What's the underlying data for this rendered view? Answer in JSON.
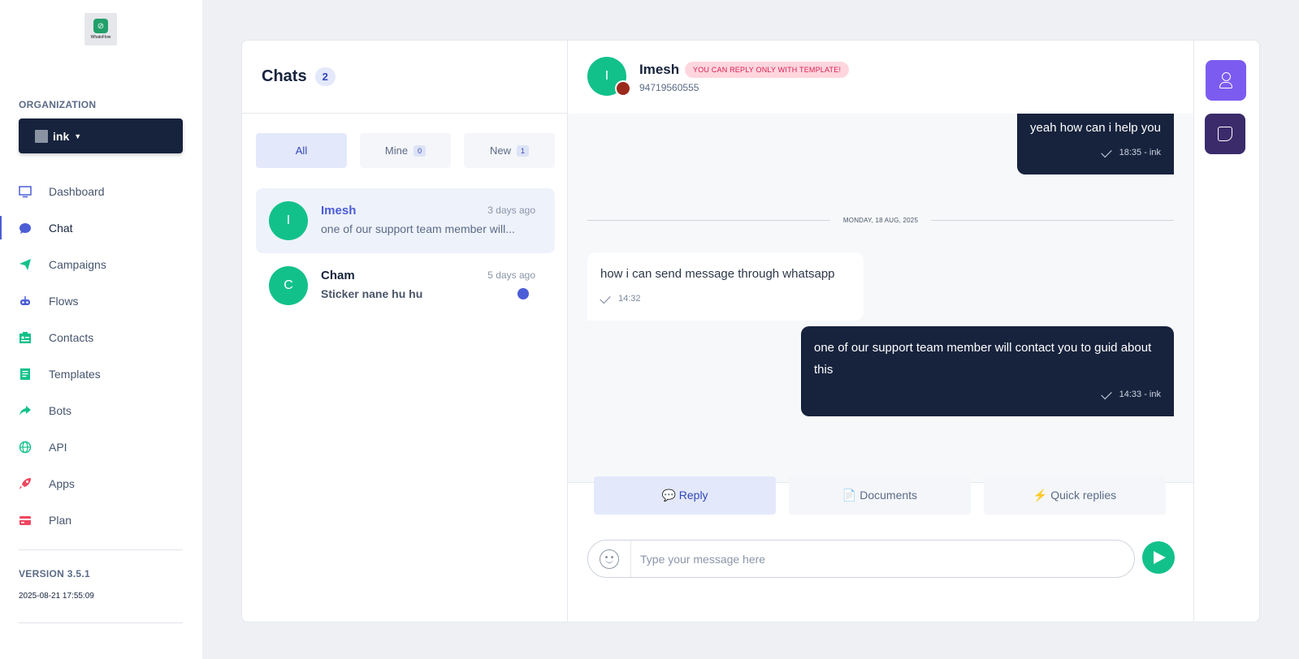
{
  "brand": {
    "logo_text": "WhatsFlow"
  },
  "organization": {
    "label": "ORGANIZATION",
    "name": "ink"
  },
  "nav": [
    {
      "label": "Dashboard",
      "icon": "monitor-icon"
    },
    {
      "label": "Chat",
      "icon": "chat-bubble-icon"
    },
    {
      "label": "Campaigns",
      "icon": "paper-plane-icon"
    },
    {
      "label": "Flows",
      "icon": "robot-icon"
    },
    {
      "label": "Contacts",
      "icon": "id-card-icon"
    },
    {
      "label": "Templates",
      "icon": "document-icon"
    },
    {
      "label": "Bots",
      "icon": "share-arrow-icon"
    },
    {
      "label": "API",
      "icon": "globe-icon"
    },
    {
      "label": "Apps",
      "icon": "rocket-icon"
    },
    {
      "label": "Plan",
      "icon": "credit-card-icon"
    }
  ],
  "version": {
    "label": "VERSION 3.5.1",
    "date": "2025-08-21 17:55:09"
  },
  "chats": {
    "title": "Chats",
    "count": "2",
    "filters": [
      {
        "label": "All",
        "badge": ""
      },
      {
        "label": "Mine",
        "badge": "0"
      },
      {
        "label": "New",
        "badge": "1"
      }
    ],
    "items": [
      {
        "initial": "I",
        "name": "Imesh",
        "time": "3 days ago",
        "preview": "one of our support team member will..."
      },
      {
        "initial": "C",
        "name": "Cham",
        "time": "5 days ago",
        "preview": "Sticker nane hu hu"
      }
    ]
  },
  "conversation": {
    "initial": "I",
    "name": "Imesh",
    "badge": "YOU CAN REPLY ONLY WITH TEMPLATE!",
    "phone": "94719560555",
    "messages": [
      {
        "text": "yeah how can i help you",
        "meta": "18:35 - ink"
      },
      {
        "text": "how i can send message through whatsapp",
        "meta": "14:32"
      },
      {
        "text": "one of our support team member will contact you to guid about this",
        "meta": "14:33 - ink"
      }
    ],
    "day_separator": "MONDAY, 18 AUG, 2025",
    "tabs": [
      "💬 Reply",
      "📄 Documents",
      "⚡ Quick replies"
    ],
    "input_placeholder": "Type your message here"
  },
  "colors": {
    "accent": "#4b5dd6",
    "avatar": "#12c18a",
    "dark": "#17233d",
    "warning_badge_bg": "#ffd6de",
    "warning_badge_text": "#d61f4f"
  }
}
